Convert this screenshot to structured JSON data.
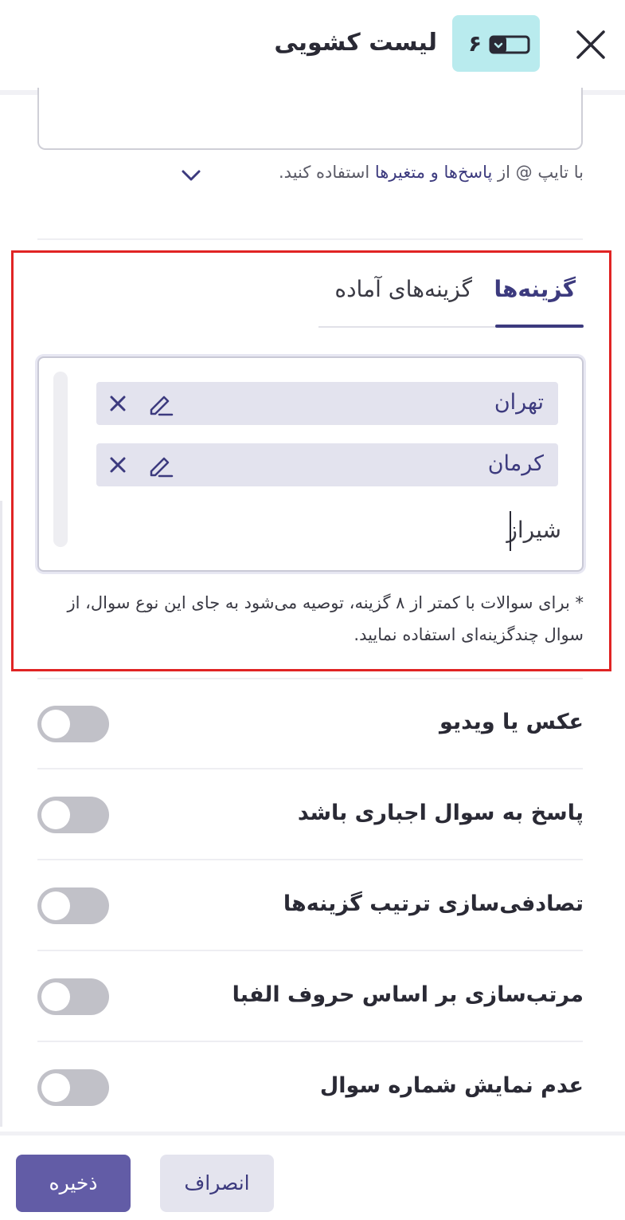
{
  "header": {
    "title": "لیست کشویی",
    "badge_number": "۶",
    "badge_icon": "dropdown-list-icon",
    "close_icon": "close-icon"
  },
  "question_text": {
    "value": ""
  },
  "hint": {
    "prefix": "با تایپ @ از ",
    "link": "پاسخ‌ها و متغیرها",
    "suffix": " استفاده کنید.",
    "expand_icon": "chevron-down-icon"
  },
  "tabs": [
    {
      "label": "گزینه‌ها",
      "active": true
    },
    {
      "label": "گزینه‌های آماده",
      "active": false
    }
  ],
  "options": [
    {
      "label": "تهران"
    },
    {
      "label": "کرمان"
    }
  ],
  "new_option_input": {
    "value": "شیراز"
  },
  "note": "* برای سوالات با کمتر از ۸ گزینه، توصیه می‌شود به جای این نوع سوال، از سوال چندگزینه‌ای استفاده نمایید.",
  "settings": [
    {
      "label": "عکس یا ویدیو",
      "enabled": false
    },
    {
      "label": "پاسخ به سوال اجباری باشد",
      "enabled": false
    },
    {
      "label": "تصادفی‌سازی ترتیب گزینه‌ها",
      "enabled": false
    },
    {
      "label": "مرتب‌سازی بر اساس حروف الفبا",
      "enabled": false
    },
    {
      "label": "عدم نمایش شماره سوال",
      "enabled": false
    }
  ],
  "footer": {
    "save_label": "ذخیره",
    "cancel_label": "انصراف"
  },
  "colors": {
    "primary": "#625ca6",
    "accent_text": "#3c3a7e",
    "badge_bg": "#b9ebee",
    "chip_bg": "#e3e3ee",
    "highlight_border": "#e02424",
    "toggle_off": "#c1c1c8"
  }
}
